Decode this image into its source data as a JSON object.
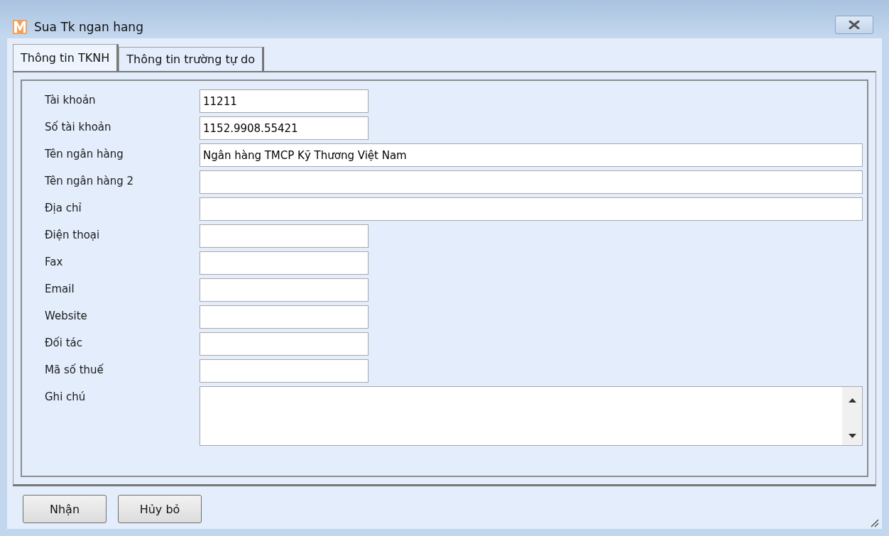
{
  "window": {
    "title": "Sua Tk ngan hang"
  },
  "tabs": [
    {
      "label": "Thông tin TKNH",
      "selected": true
    },
    {
      "label": "Thông tin trường tự do",
      "selected": false
    }
  ],
  "fields": [
    {
      "label": "Tài khoản",
      "kind": "short",
      "value": "11211"
    },
    {
      "label": "Số tài khoản",
      "kind": "short",
      "value": "1152.9908.55421"
    },
    {
      "label": "Tên ngân hàng",
      "kind": "long",
      "value": "Ngân hàng TMCP Kỹ Thương Việt Nam"
    },
    {
      "label": "Tên ngân hàng 2",
      "kind": "long"
    },
    {
      "label": "Địa chỉ",
      "kind": "long"
    },
    {
      "label": "Điện thoại",
      "kind": "short"
    },
    {
      "label": "Fax",
      "kind": "short"
    },
    {
      "label": "Email",
      "kind": "short"
    },
    {
      "label": "Website",
      "kind": "short"
    },
    {
      "label": "Đối tác",
      "kind": "short"
    },
    {
      "label": "Mã số thuế",
      "kind": "short"
    },
    {
      "label": "Ghi chú",
      "kind": "memo"
    }
  ],
  "buttons": [
    "Nhận",
    "Hủy bỏ"
  ]
}
